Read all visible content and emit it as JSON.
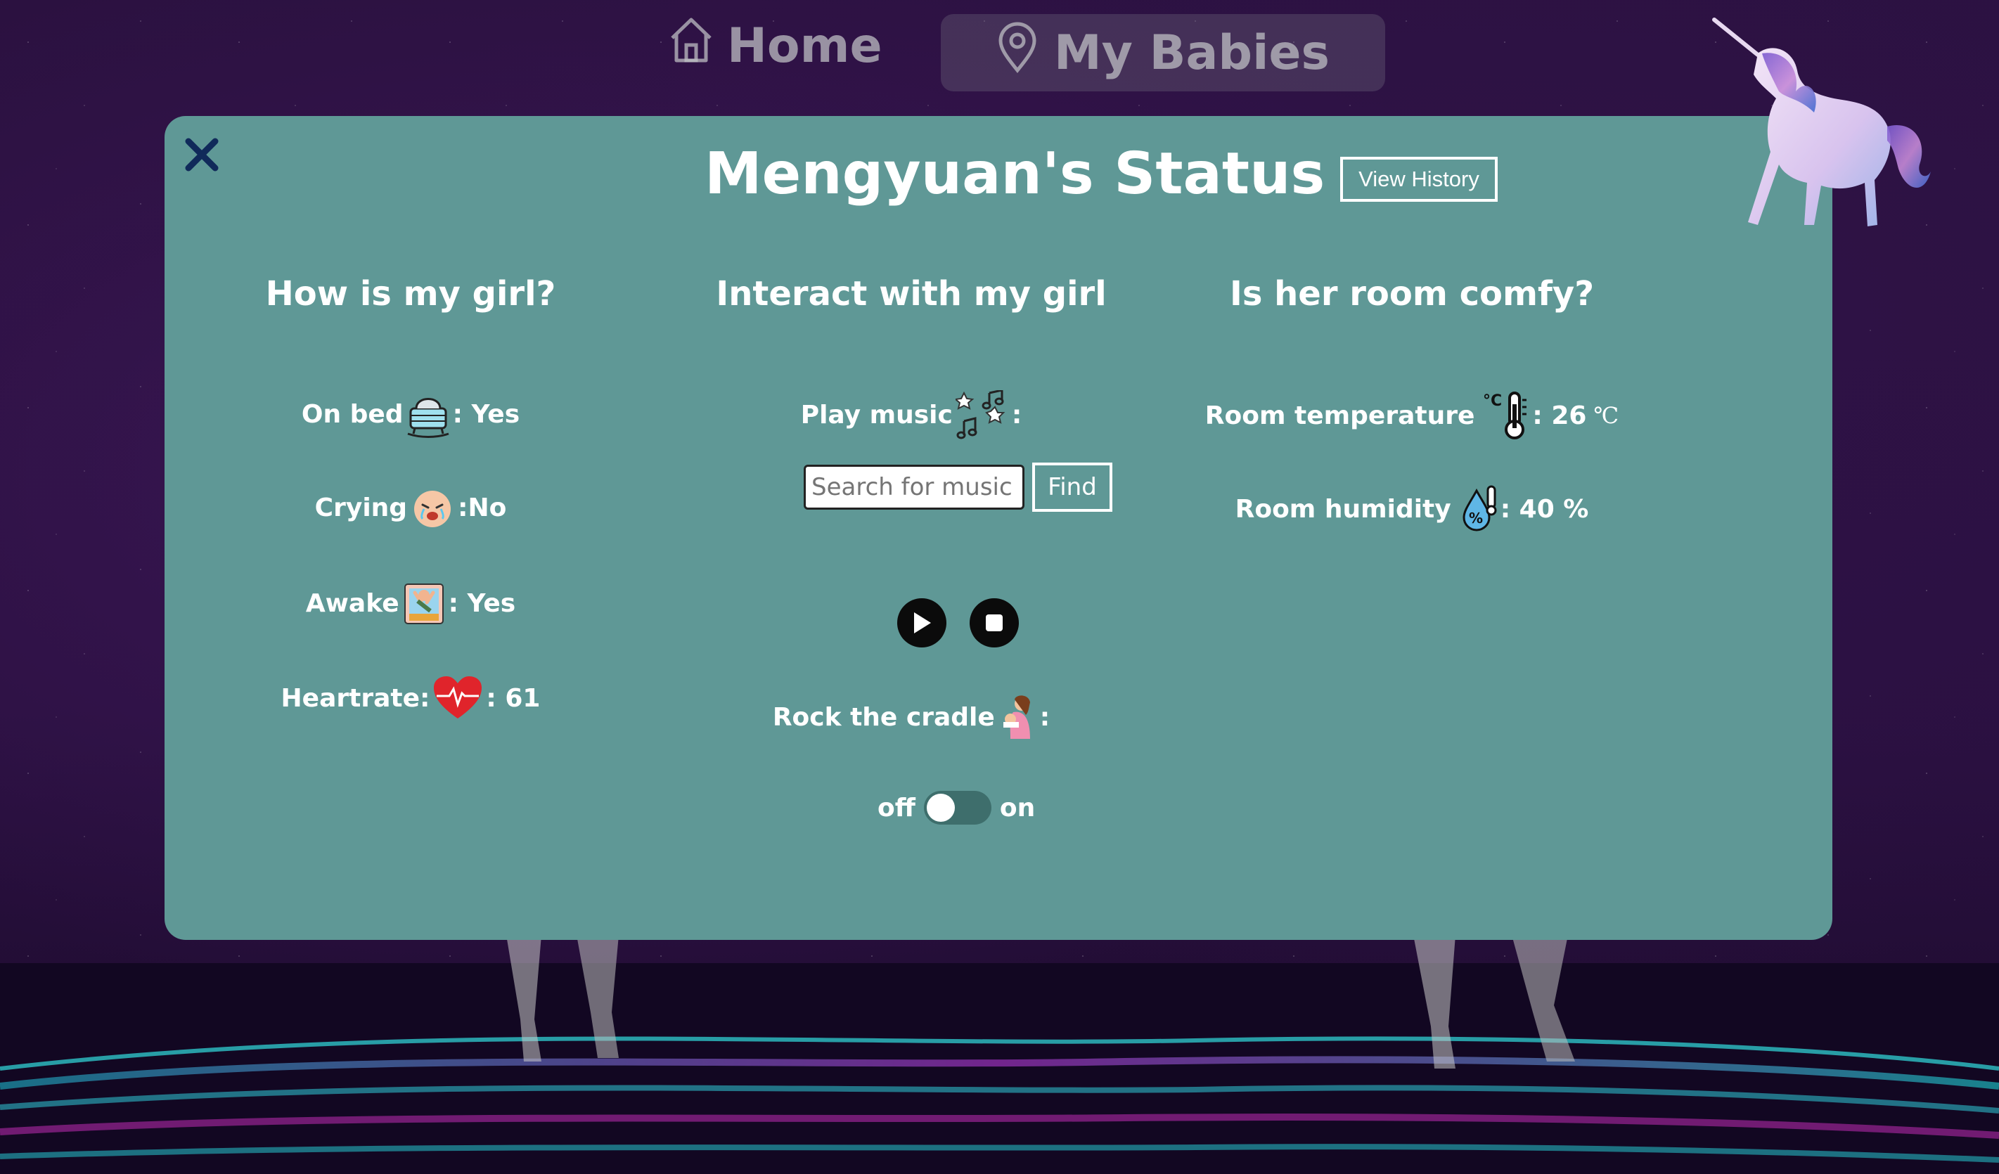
{
  "nav": {
    "home_label": "Home",
    "babies_label": "My Babies"
  },
  "modal": {
    "title": "Mengyuan's Status",
    "history_label": "View History"
  },
  "left": {
    "heading": "How is my girl?",
    "on_bed_label": "On bed",
    "on_bed_value": ": Yes",
    "crying_label": "Crying",
    "crying_value": ":No",
    "awake_label": "Awake",
    "awake_value": ": Yes",
    "heartrate_label": "Heartrate:",
    "heartrate_value": ": 61"
  },
  "middle": {
    "heading": "Interact with my girl",
    "music_label": "Play music",
    "music_colon": ":",
    "search_placeholder": "Search for music",
    "find_label": "Find",
    "cradle_label": "Rock the cradle",
    "cradle_colon": ":",
    "toggle_off": "off",
    "toggle_on": "on",
    "cradle_on": false
  },
  "right": {
    "heading": "Is her room comfy?",
    "temp_label": "Room temperature",
    "temp_value": ": 26",
    "temp_unit": "℃",
    "humidity_label": "Room humidity",
    "humidity_value": ": 40 %"
  }
}
